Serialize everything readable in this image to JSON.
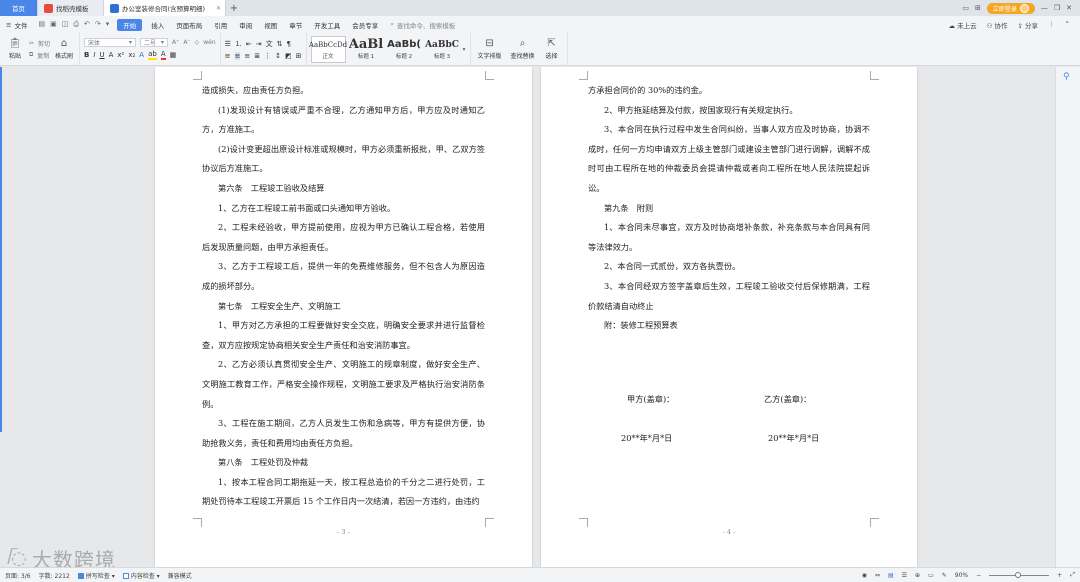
{
  "titlebar": {
    "home_tab": "首页",
    "tabs": [
      {
        "label": "找稻壳模板"
      },
      {
        "label": "办公室装修合同(含预算明细)"
      }
    ],
    "new_tab": "+",
    "login": "立即登录"
  },
  "menubar": {
    "file": "文件",
    "items": [
      "开始",
      "插入",
      "页面布局",
      "引用",
      "审阅",
      "视图",
      "章节",
      "开发工具",
      "会员专享"
    ],
    "active": "开始",
    "search_placeholder": "查找命令、搜索模板",
    "right": [
      "未上云",
      "协作",
      "分享"
    ]
  },
  "ribbon": {
    "paste": "粘贴",
    "cut": "剪切",
    "copy": "复制",
    "format_painter": "格式刷",
    "font_name": "宋体",
    "font_size": "二号",
    "styles": [
      {
        "preview": "AaBbCcDd",
        "label": "正文"
      },
      {
        "preview": "AaBl",
        "label": "标题 1"
      },
      {
        "preview": "AaBb(",
        "label": "标题 2"
      },
      {
        "preview": "AaBbC",
        "label": "标题 3"
      }
    ],
    "text_layout": "文字排版",
    "find_replace": "查找替换",
    "select": "选择"
  },
  "page3": {
    "paragraphs": [
      {
        "text": "造成损失，应由责任方负担。",
        "indent": false
      },
      {
        "text": "(1)发现设计有错误或严重不合理，乙方通知甲方后，甲方应及时通知乙方，方准施工。",
        "indent": true
      },
      {
        "text": "(2)设计变更超出原设计标准或规模时，甲方必须重新报批，甲、乙双方签协议后方准施工。",
        "indent": true
      },
      {
        "text": "第六条　工程竣工验收及结算",
        "indent": true
      },
      {
        "text": "1、乙方在工程竣工前书面或口头通知甲方验收。",
        "indent": true
      },
      {
        "text": "2、工程未经验收，甲方提前使用，应视为甲方已确认工程合格，若使用后发现质量问题，由甲方承担责任。",
        "indent": true
      },
      {
        "text": "3、乙方于工程竣工后，提供一年的免费维修服务，但不包含人为原因造成的损坏部分。",
        "indent": true
      },
      {
        "text": "第七条　工程安全生产、文明施工",
        "indent": true
      },
      {
        "text": "1、甲方对乙方承担的工程要做好安全交底，明确安全要求并进行监督检查，双方应按规定协商相关安全生产责任和治安消防事宜。",
        "indent": true
      },
      {
        "text": "2、乙方必须认真贯彻安全生产、文明施工的规章制度，做好安全生产、文明施工教育工作，严格安全操作规程，文明施工要求及严格执行治安消防条例。",
        "indent": true
      },
      {
        "text": "3、工程在施工期间，乙方人员发生工伤和急病等，甲方有提供方便，协助抢救义务，责任和费用均由责任方负担。",
        "indent": true
      },
      {
        "text": "第八条　工程处罚及仲裁",
        "indent": true
      },
      {
        "text": "1、按本工程合同工期拖延一天，按工程总造价的千分之二进行处罚，工期处罚待本工程竣工开票后 15 个工作日内一次结清，若因一方违约，由违约",
        "indent": true
      }
    ],
    "page_number": "- 3 -"
  },
  "page4": {
    "paragraphs": [
      {
        "text": "方承担合同价的 30%的违约金。",
        "indent": false
      },
      {
        "text": "2、甲方拖延结算及付款，按国家现行有关规定执行。",
        "indent": true
      },
      {
        "text": "3、本合同在执行过程中发生合同纠纷，当事人双方应及时协商，协调不成时，任何一方均申请双方上级主管部门或建设主管部门进行调解，调解不成时可由工程所在地的仲裁委员会提请仲裁或者向工程所在地人民法院提起诉讼。",
        "indent": true
      },
      {
        "text": "第九条　附则",
        "indent": true
      },
      {
        "text": "1、本合同未尽事宜，双方及时协商增补条款，补充条款与本合同具有同等法律效力。",
        "indent": true
      },
      {
        "text": "2、本合同一式贰份，双方各执壹份。",
        "indent": true
      },
      {
        "text": "3、本合同经双方签字盖章后生效，工程竣工验收交付后保修期满，工程价款结清自动终止",
        "indent": true
      },
      {
        "text": "附：装修工程预算表",
        "indent": true
      }
    ],
    "party_a": "甲方(盖章)：",
    "party_b": "乙方(盖章)：",
    "date_a": "20**年*月*日",
    "date_b": "20**年*月*日",
    "page_number": "- 4 -"
  },
  "statusbar": {
    "page": "页面: 3/6",
    "words": "字数: 2212",
    "spell": "拼写检查",
    "content_check": "内容检查",
    "compat": "兼容模式",
    "zoom": "90%",
    "zoom_level": 0.48
  },
  "watermark": "大数跨境"
}
